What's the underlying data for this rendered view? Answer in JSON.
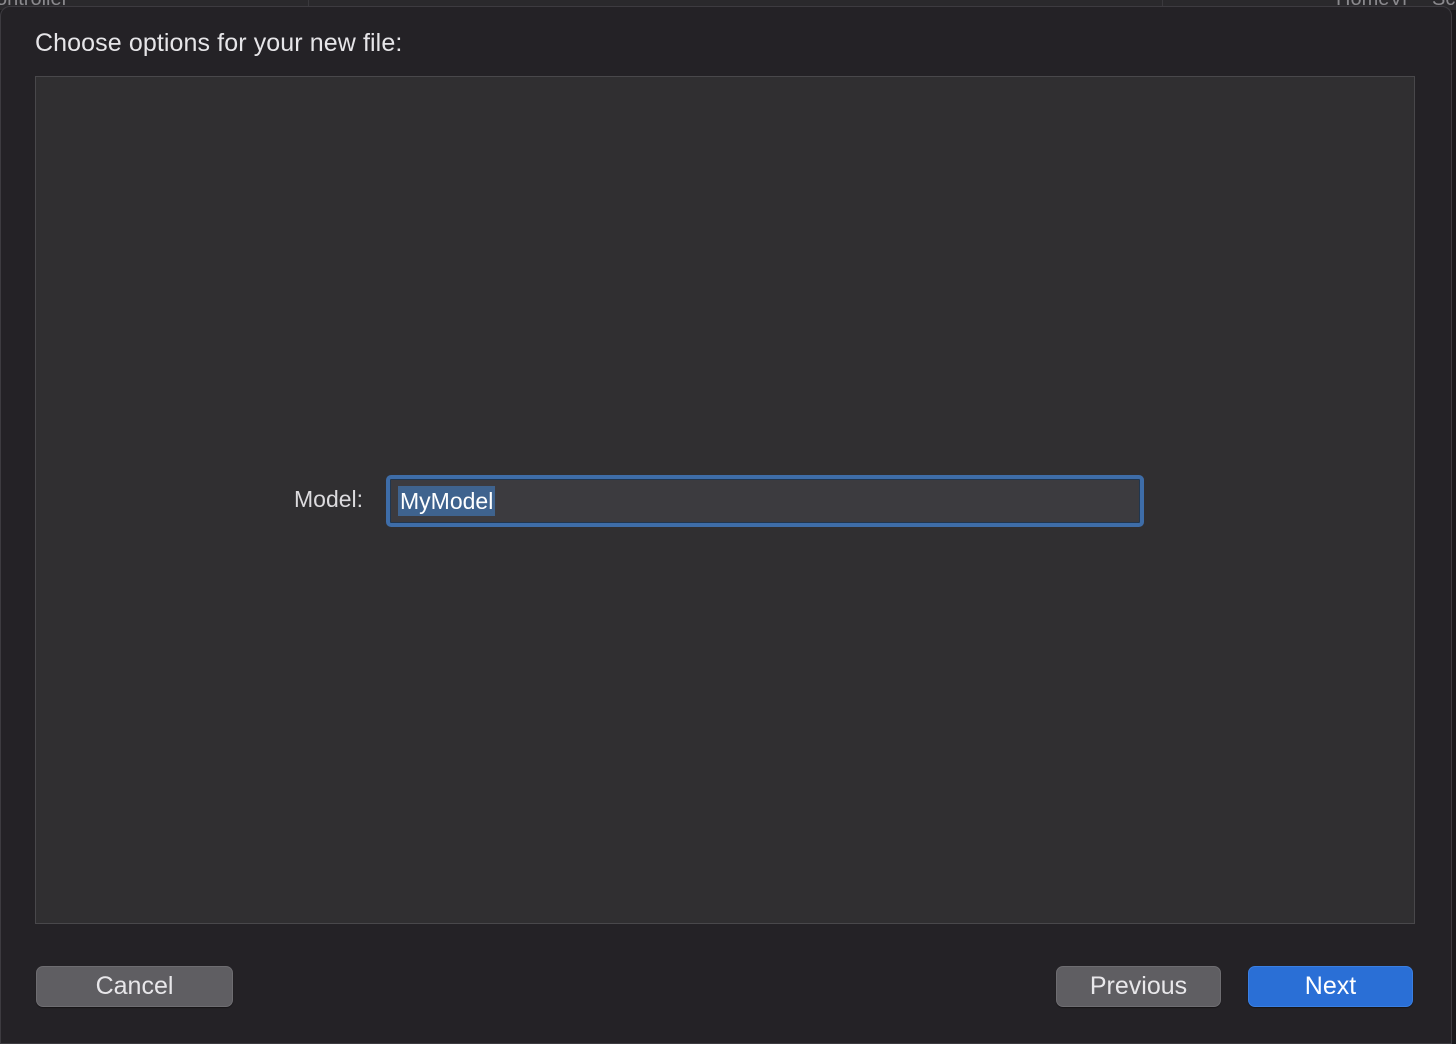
{
  "background_window": {
    "left_text": "ontroller",
    "right_text": "HomeVi",
    "right_text_2": "Sc"
  },
  "sheet": {
    "title": "Choose options for your new file:"
  },
  "form": {
    "model_label": "Model:",
    "model_value": "MyModel",
    "model_value_selected": true
  },
  "buttons": {
    "cancel": "Cancel",
    "previous": "Previous",
    "next": "Next"
  },
  "colors": {
    "accent": "#2a6fd6",
    "focus_ring": "#3e6da8",
    "selection": "#3f638e"
  }
}
